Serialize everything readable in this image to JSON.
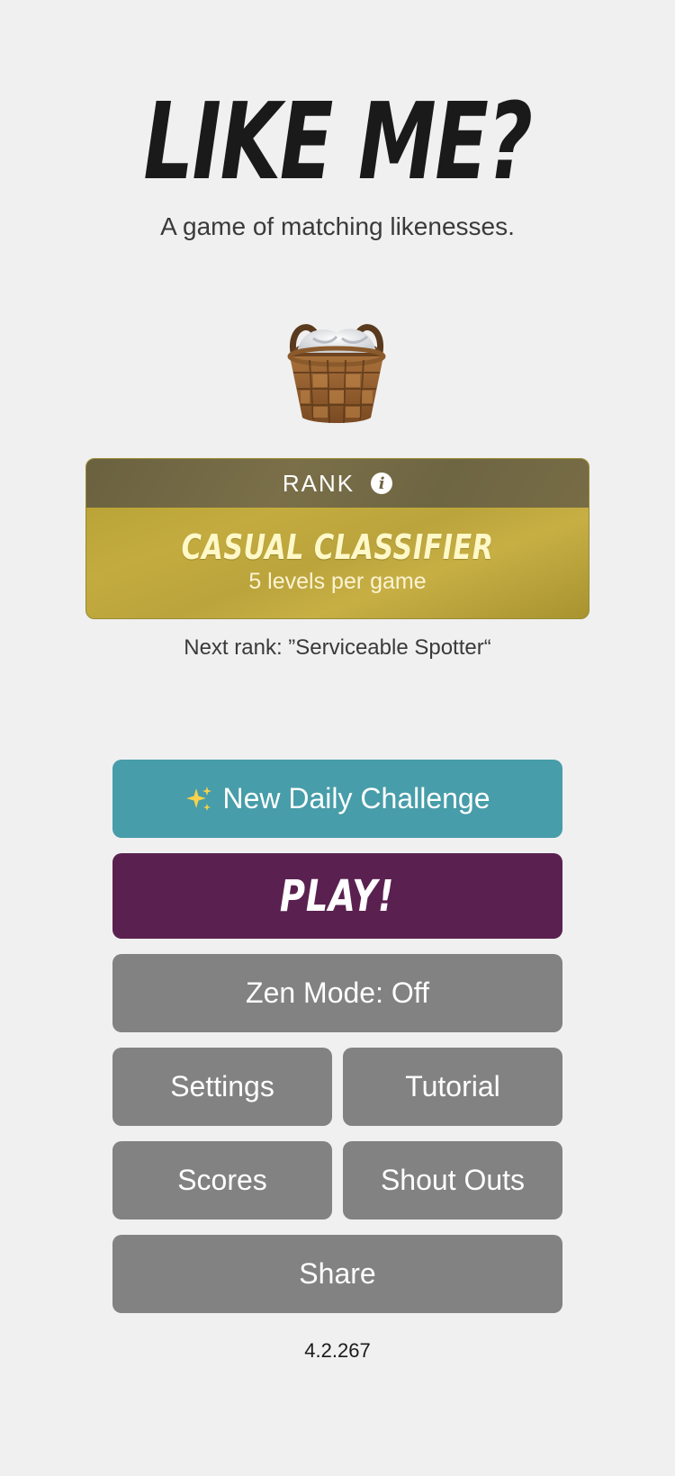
{
  "app": {
    "title": "LIKE ME?",
    "subtitle": "A game of matching likenesses."
  },
  "mascot_icon": "laundry-basket-icon",
  "rank": {
    "header_label": "RANK",
    "info_icon": "info-icon",
    "info_glyph": "i",
    "name": "CASUAL CLASSIFIER",
    "detail": "5 levels per game",
    "next_rank": "Next rank: ”Serviceable Spotter“",
    "colors": {
      "header": "#716844",
      "body": "#bea73c",
      "name_text": "#fff8c8"
    }
  },
  "buttons": {
    "daily_icon": "sparkles-icon",
    "daily_label": "New Daily Challenge",
    "play_label": "PLAY!",
    "zen_label": "Zen Mode: Off",
    "settings_label": "Settings",
    "tutorial_label": "Tutorial",
    "scores_label": "Scores",
    "shout_outs_label": "Shout Outs",
    "share_label": "Share"
  },
  "colors": {
    "background": "#f0f0f0",
    "daily_button": "#479da9",
    "play_button": "#5a2150",
    "secondary_button": "#828282"
  },
  "version": "4.2.267"
}
